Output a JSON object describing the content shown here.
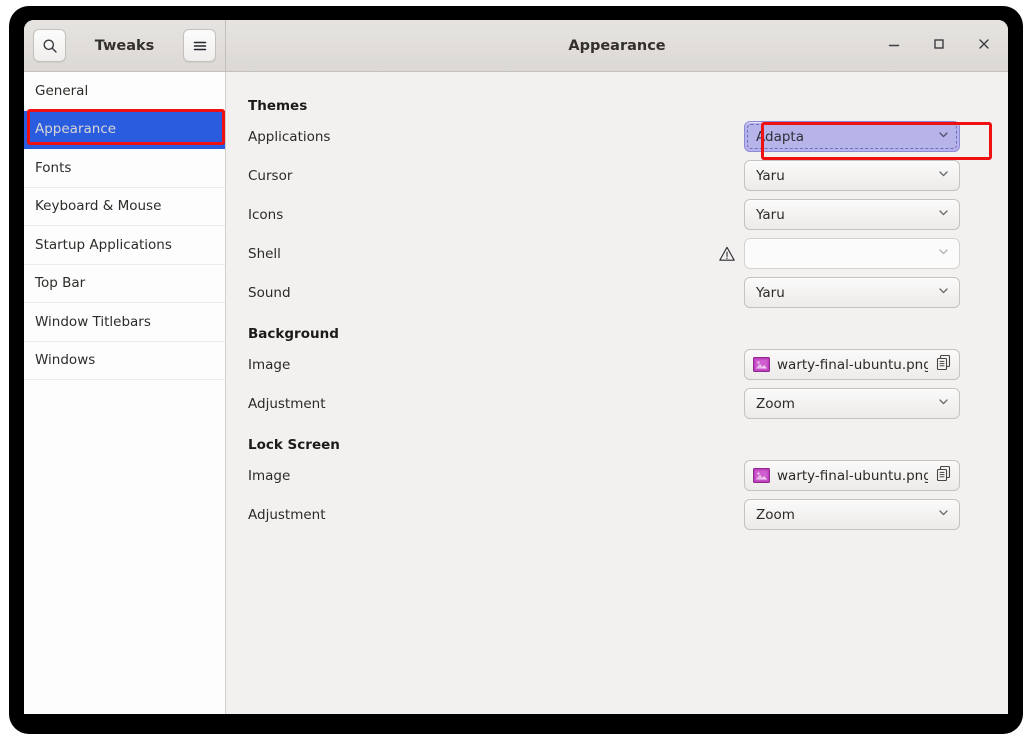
{
  "window": {
    "app_title": "Tweaks",
    "page_title": "Appearance",
    "search_icon": "search-icon",
    "menu_icon": "hamburger-menu-icon",
    "controls": {
      "minimize": "minimize-icon",
      "maximize": "maximize-icon",
      "close": "close-icon"
    }
  },
  "sidebar": {
    "items": [
      {
        "label": "General",
        "selected": false
      },
      {
        "label": "Appearance",
        "selected": true
      },
      {
        "label": "Fonts",
        "selected": false
      },
      {
        "label": "Keyboard & Mouse",
        "selected": false
      },
      {
        "label": "Startup Applications",
        "selected": false
      },
      {
        "label": "Top Bar",
        "selected": false
      },
      {
        "label": "Window Titlebars",
        "selected": false
      },
      {
        "label": "Windows",
        "selected": false
      }
    ]
  },
  "sections": {
    "themes": {
      "title": "Themes",
      "rows": [
        {
          "label": "Applications",
          "value": "Adapta",
          "state": "focused"
        },
        {
          "label": "Cursor",
          "value": "Yaru",
          "state": "normal"
        },
        {
          "label": "Icons",
          "value": "Yaru",
          "state": "normal"
        },
        {
          "label": "Shell",
          "value": "",
          "state": "empty",
          "warning": "warning-triangle-icon"
        },
        {
          "label": "Sound",
          "value": "Yaru",
          "state": "normal"
        }
      ]
    },
    "background": {
      "title": "Background",
      "image": {
        "label": "Image",
        "value": "warty-final-ubuntu.png"
      },
      "adjustment": {
        "label": "Adjustment",
        "value": "Zoom"
      }
    },
    "lock_screen": {
      "title": "Lock Screen",
      "image": {
        "label": "Image",
        "value": "warty-final-ubuntu.png"
      },
      "adjustment": {
        "label": "Adjustment",
        "value": "Zoom"
      }
    }
  },
  "colors": {
    "selection_blue": "#2a5ce0",
    "focus_purple": "#b7b4ea",
    "annotation_red": "#ef1111",
    "content_bg": "#f2f1f0",
    "sidebar_bg": "#fdfdfd",
    "headerbar_bg": "#e0ddda"
  },
  "annotations": [
    {
      "name": "annotation-sidebar-appearance"
    },
    {
      "name": "annotation-applications-theme"
    }
  ]
}
